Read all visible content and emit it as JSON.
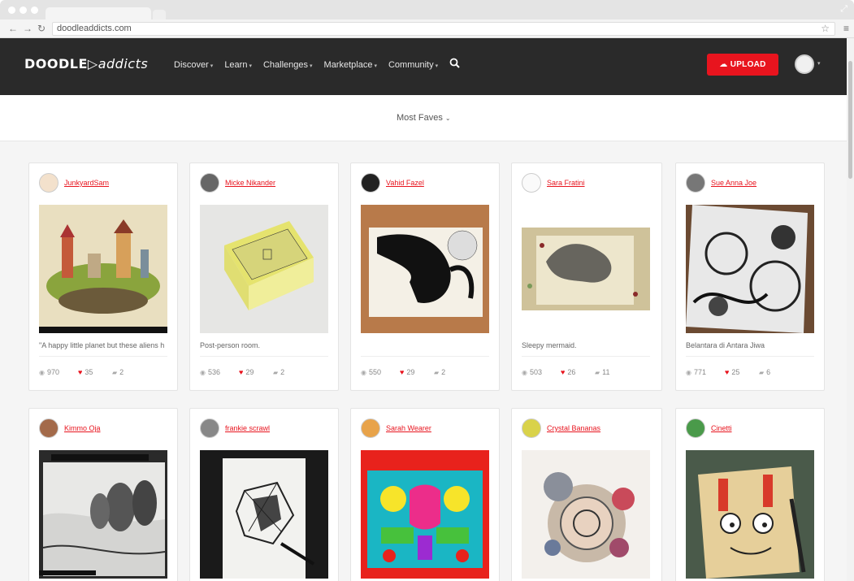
{
  "browser": {
    "url": "doodleaddicts.com"
  },
  "header": {
    "logo_text_a": "DOODLE",
    "logo_text_b": "addicts",
    "nav": [
      {
        "label": "Discover"
      },
      {
        "label": "Learn"
      },
      {
        "label": "Challenges"
      },
      {
        "label": "Marketplace"
      },
      {
        "label": "Community"
      }
    ],
    "upload_label": "UPLOAD",
    "accent_color": "#e8141e"
  },
  "sort": {
    "label": "Most Faves"
  },
  "cards": [
    {
      "user": "JunkyardSam",
      "caption": "\"A happy little planet but these aliens h",
      "views": "970",
      "faves": "35",
      "comments": "2"
    },
    {
      "user": "Micke Nikander",
      "caption": "Post-person room.",
      "views": "536",
      "faves": "29",
      "comments": "2"
    },
    {
      "user": "Vahid Fazel",
      "caption": "",
      "views": "550",
      "faves": "29",
      "comments": "2"
    },
    {
      "user": "Sara Fratini",
      "caption": "Sleepy mermaid.",
      "views": "503",
      "faves": "26",
      "comments": "11"
    },
    {
      "user": "Sue Anna Joe",
      "caption": "Belantara di Antara Jiwa",
      "views": "771",
      "faves": "25",
      "comments": "6"
    },
    {
      "user": "Kimmo Oja",
      "caption": "",
      "views": "",
      "faves": "",
      "comments": ""
    },
    {
      "user": "frankie scrawl",
      "caption": "",
      "views": "",
      "faves": "",
      "comments": ""
    },
    {
      "user": "Sarah Wearer",
      "caption": "",
      "views": "",
      "faves": "",
      "comments": ""
    },
    {
      "user": "Crystal Bananas",
      "caption": "",
      "views": "",
      "faves": "",
      "comments": ""
    },
    {
      "user": "Cinetti",
      "caption": "",
      "views": "",
      "faves": "",
      "comments": ""
    }
  ]
}
